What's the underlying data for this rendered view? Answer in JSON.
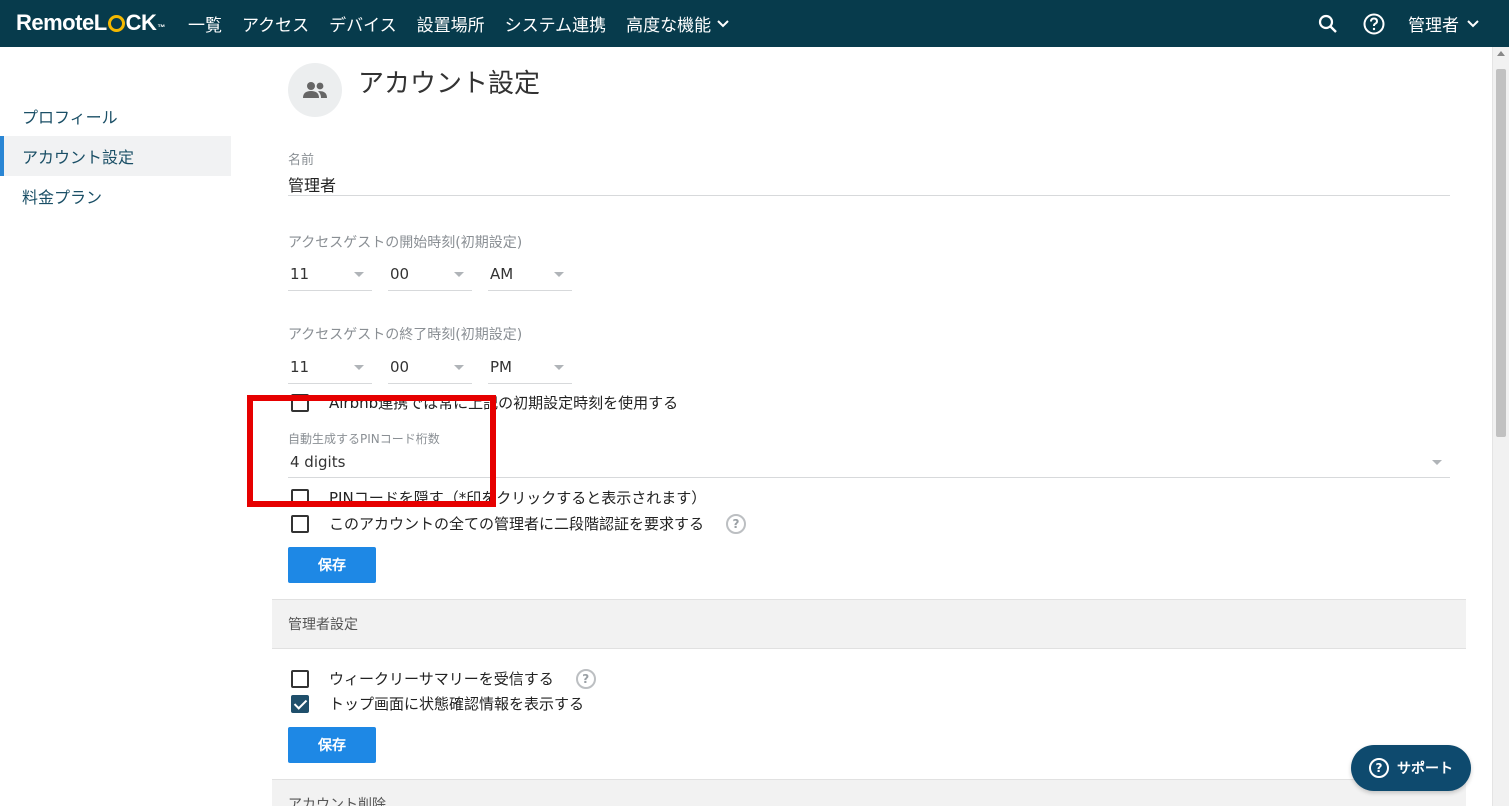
{
  "nav": {
    "logo_prefix": "Remote",
    "logo_l": "L",
    "logo_suffix": "CK",
    "logo_tm": "™",
    "items": [
      {
        "label": "一覧"
      },
      {
        "label": "アクセス"
      },
      {
        "label": "デバイス"
      },
      {
        "label": "設置場所"
      },
      {
        "label": "システム連携"
      },
      {
        "label": "高度な機能"
      }
    ],
    "user": "管理者"
  },
  "sidebar": {
    "items": [
      {
        "label": "プロフィール"
      },
      {
        "label": "アカウント設定"
      },
      {
        "label": "料金プラン"
      }
    ]
  },
  "page": {
    "title": "アカウント設定",
    "name_label": "名前",
    "name_value": "管理者",
    "start_label": "アクセスゲストの開始時刻(初期設定)",
    "start_hour": "11",
    "start_min": "00",
    "start_ampm": "AM",
    "end_label": "アクセスゲストの終了時刻(初期設定)",
    "end_hour": "11",
    "end_min": "00",
    "end_ampm": "PM",
    "airbnb_label": "Airbnb連携では常に上記の初期設定時刻を使用する",
    "pin_label": "自動生成するPINコード桁数",
    "pin_value": "4 digits",
    "hide_pin_label": "PINコードを隠す（*印をクリックすると表示されます）",
    "two_factor_label": "このアカウントの全ての管理者に二段階認証を要求する",
    "save_label": "保存"
  },
  "admin": {
    "section_title": "管理者設定",
    "weekly_label": "ウィークリーサマリーを受信する",
    "status_label": "トップ画面に状態確認情報を表示する",
    "save_label": "保存"
  },
  "delete": {
    "section_title": "アカウント削除"
  },
  "support": {
    "label": "サポート",
    "icon_glyph": "?"
  },
  "help_glyph": "?",
  "colors": {
    "nav_bg": "#073b4c",
    "primary": "#1e88e5",
    "active_indicator": "#2a86d4",
    "annotation": "#e60000",
    "support_bg": "#0e4a6e"
  }
}
